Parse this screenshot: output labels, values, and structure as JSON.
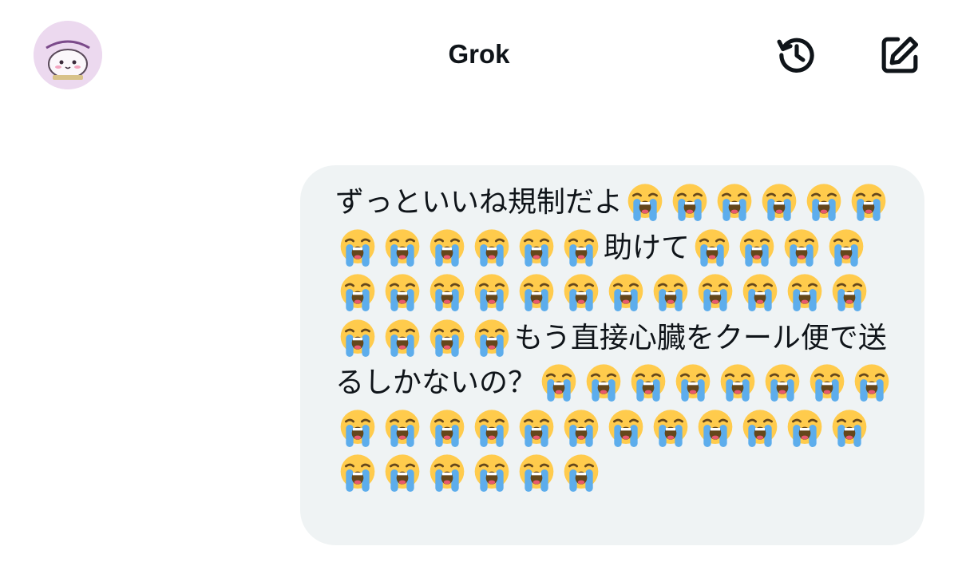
{
  "header": {
    "title": "Grok",
    "avatar_icon": "profile-avatar",
    "history_icon": "history-icon",
    "compose_icon": "compose-icon"
  },
  "message": {
    "role": "user",
    "text": "ずっといいね規制だよ😭😭😭😭😭😭😭😭😭😭😭😭助けて😭😭😭😭😭😭😭😭😭😭😭😭😭😭😭😭😭😭😭😭もう直接心臓をクール便で送るしかないの？😭😭😭😭😭😭😭😭😭😭😭😭😭😭😭😭😭😭😭😭😭😭😭😭😭😭"
  },
  "colors": {
    "bubble": "#eff3f4",
    "text": "#0f1419",
    "avatar_bg": "#ecd9ef"
  }
}
